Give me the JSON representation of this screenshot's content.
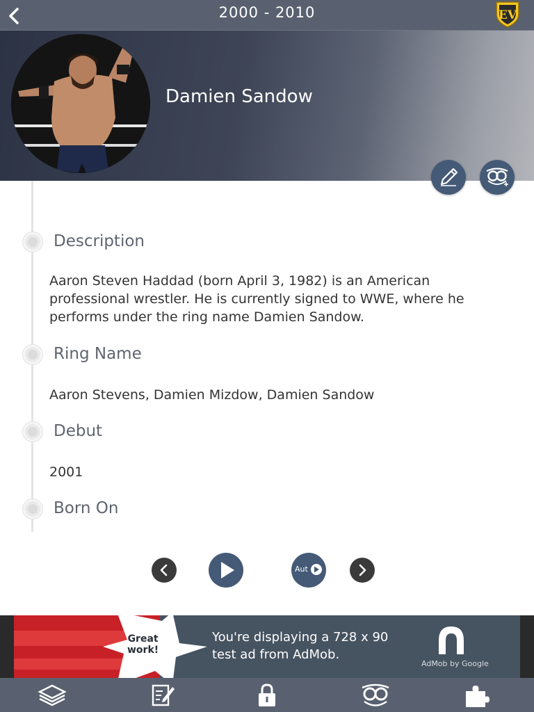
{
  "header": {
    "title": "2000 - 2010",
    "logo_text": "EV"
  },
  "profile": {
    "name": "Damien Sandow"
  },
  "sections": [
    {
      "title": "Description",
      "text": "Aaron Steven Haddad (born April 3, 1982) is an American professional wrestler. He is currently signed to WWE, where he performs under the ring name Damien Sandow."
    },
    {
      "title": "Ring Name",
      "text": "Aaron Stevens, Damien Mizdow, Damien Sandow"
    },
    {
      "title": "Debut",
      "text": "2001"
    },
    {
      "title": "Born On",
      "text": ""
    }
  ],
  "controls": {
    "auto_label": "Aut"
  },
  "ad": {
    "badge": "Great work!",
    "badge_line1": "Great",
    "badge_line2": "work!",
    "text": "You're displaying a 728 x 90 test ad from AdMob.",
    "brand": "AdMob by Google"
  },
  "icons": {
    "back": "chevron-left-icon",
    "edit": "pencil-icon",
    "add_person": "owl-add-icon",
    "prev": "chevron-left-circle-icon",
    "play": "play-icon",
    "auto": "autoplay-icon",
    "next": "chevron-right-circle-icon",
    "tabs": [
      "ring-icon",
      "notes-icon",
      "lock-icon",
      "owl-icon",
      "puzzle-icon"
    ]
  },
  "colors": {
    "bar": "#596170",
    "accent": "#445a76",
    "text": "#333333",
    "section_title": "#5f6470"
  }
}
